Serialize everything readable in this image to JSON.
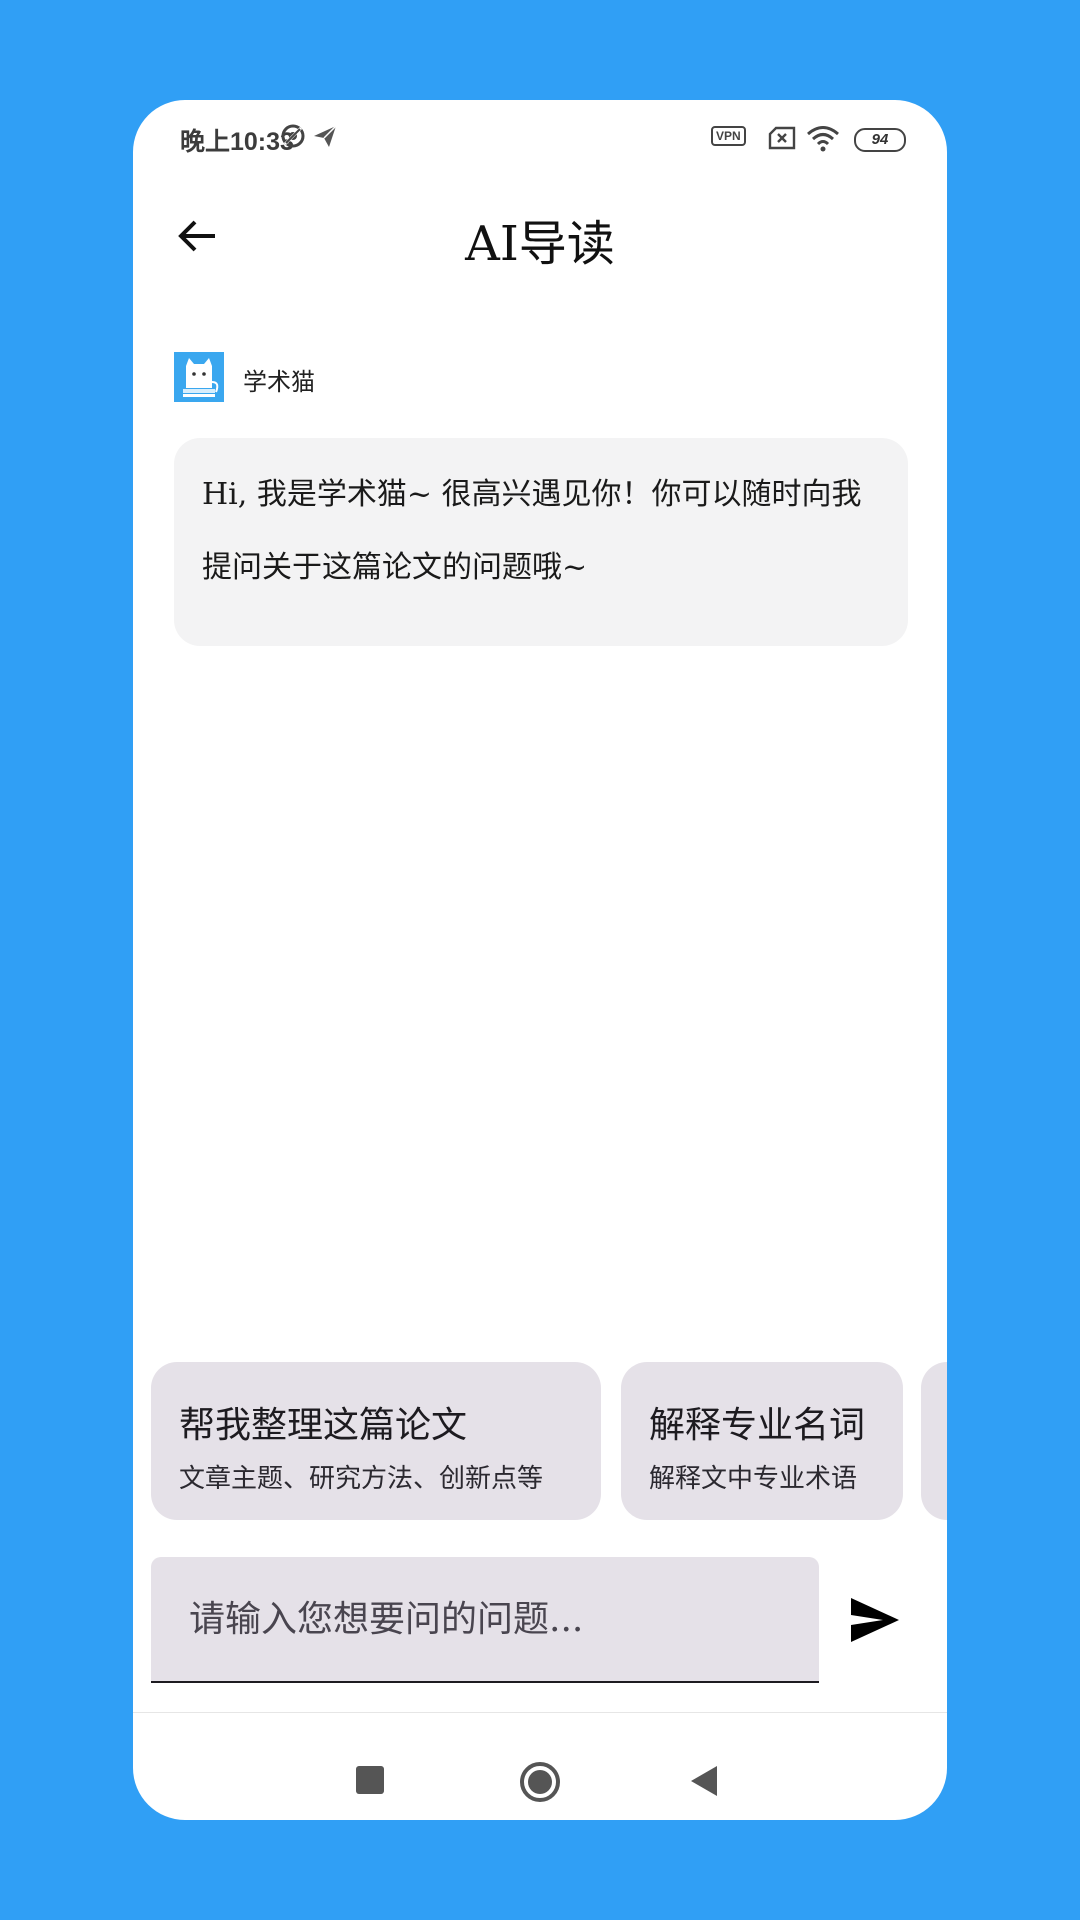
{
  "status_bar": {
    "time": "晚上10:33",
    "vpn_label": "VPN",
    "battery": "94",
    "icons": [
      "do-not-disturb-icon",
      "send-telegram-icon",
      "vpn-icon",
      "sim-x-icon",
      "wifi-icon",
      "battery-icon"
    ]
  },
  "header": {
    "title": "AI导读",
    "back_icon": "arrow-left-icon"
  },
  "chat": {
    "bot_name": "学术猫",
    "bot_avatar_icon": "cat-avatar-icon",
    "message": "Hi, 我是学术猫~ 很高兴遇见你！你可以随时向我提问关于这篇论文的问题哦~"
  },
  "suggestions": [
    {
      "title": "帮我整理这篇论文",
      "subtitle": "文章主题、研究方法、创新点等"
    },
    {
      "title": "解释专业名词",
      "subtitle": "解释文中专业术语"
    }
  ],
  "input": {
    "placeholder": "请输入您想要问的问题...",
    "value": "",
    "send_icon": "send-icon"
  },
  "nav": {
    "icons": [
      "recents-square-icon",
      "home-circle-icon",
      "back-triangle-icon"
    ]
  },
  "colors": {
    "background": "#309ff5",
    "card": "#ffffff",
    "bubble": "#f3f3f4",
    "chip": "#e5e1e8",
    "avatar": "#3aa7ef"
  }
}
